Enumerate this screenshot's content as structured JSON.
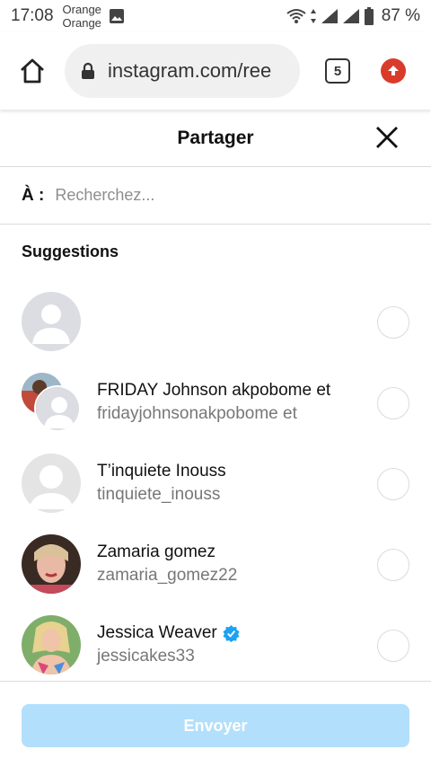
{
  "status_bar": {
    "time": "17:08",
    "carrier_line1": "Orange",
    "carrier_line2": "Orange",
    "battery": "87 %"
  },
  "browser": {
    "url": "instagram.com/ree",
    "tab_count": "5"
  },
  "share": {
    "title": "Partager",
    "to_label": "À :",
    "search_placeholder": "Recherchez...",
    "suggestions_title": "Suggestions",
    "send_label": "Envoyer"
  },
  "suggestions": [
    {
      "name": "",
      "username": ""
    },
    {
      "name": "FRIDAY Johnson akpobome et",
      "username": "fridayjohnsonakpobome et"
    },
    {
      "name": "T’inquiete Inouss",
      "username": "tinquiete_inouss"
    },
    {
      "name": "Zamaria gomez",
      "username": "zamaria_gomez22"
    },
    {
      "name": "Jessica Weaver",
      "username": "jessicakes33"
    }
  ],
  "colors": {
    "send_disabled": "#b2dffc",
    "verified": "#1da1f2",
    "update_badge": "#d93b2b"
  }
}
